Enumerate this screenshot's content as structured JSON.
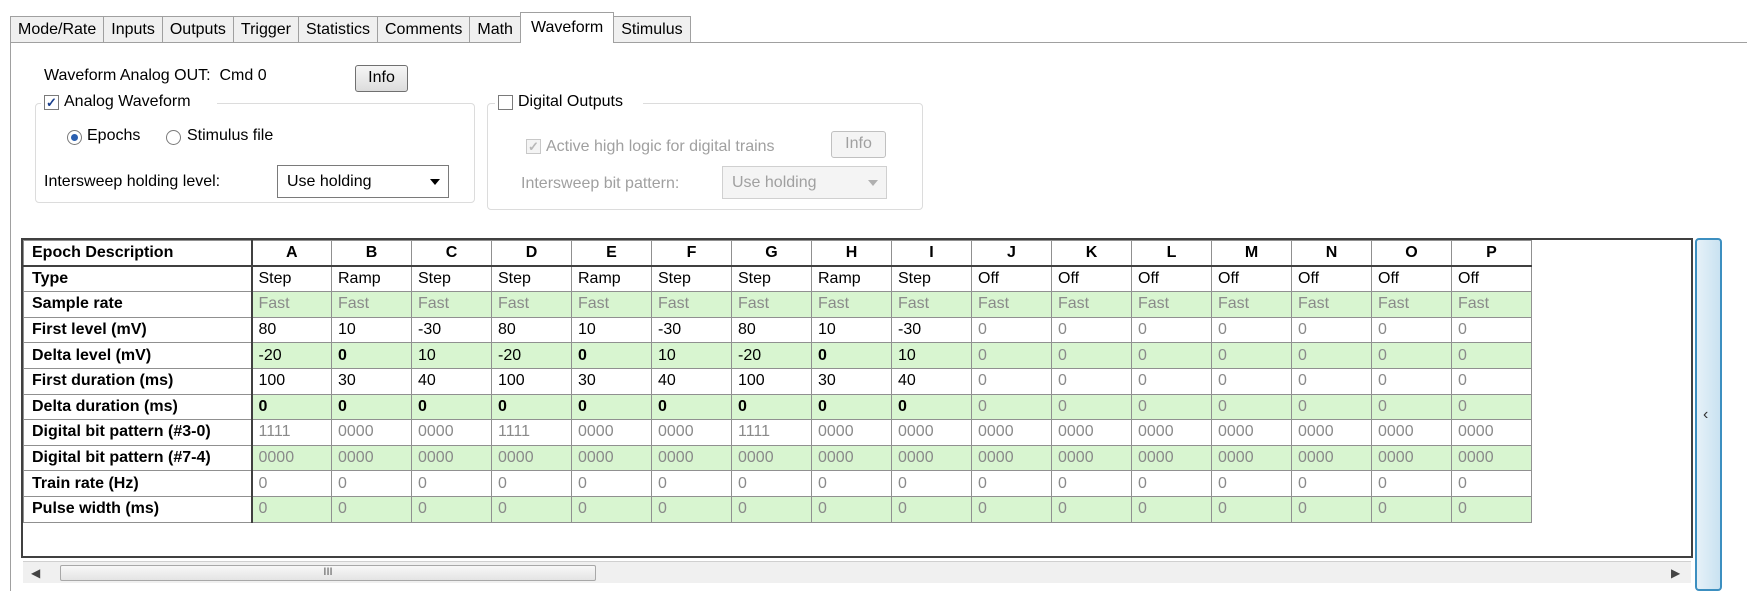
{
  "tabs": [
    {
      "label": "Mode/Rate",
      "active": false
    },
    {
      "label": "Inputs",
      "active": false
    },
    {
      "label": "Outputs",
      "active": false
    },
    {
      "label": "Trigger",
      "active": false
    },
    {
      "label": "Statistics",
      "active": false
    },
    {
      "label": "Comments",
      "active": false
    },
    {
      "label": "Math",
      "active": false
    },
    {
      "label": "Waveform",
      "active": true
    },
    {
      "label": "Stimulus",
      "active": false
    }
  ],
  "waveform_out": {
    "label": "Waveform Analog OUT:",
    "channel": "Cmd 0",
    "info_button": "Info"
  },
  "analog": {
    "checkbox_label": "Analog Waveform",
    "checked": true,
    "epochs_label": "Epochs",
    "stimulus_file_label": "Stimulus file",
    "selected": "Epochs",
    "holding_label": "Intersweep holding level:",
    "holding_value": "Use holding"
  },
  "digital": {
    "checkbox_label": "Digital Outputs",
    "checked": false,
    "active_high_label": "Active high logic for digital trains",
    "active_high_checked": true,
    "info_button": "Info",
    "bit_pattern_label": "Intersweep bit pattern:",
    "bit_pattern_value": "Use holding"
  },
  "grid": {
    "header": "Epoch Description",
    "columns": [
      "A",
      "B",
      "C",
      "D",
      "E",
      "F",
      "G",
      "H",
      "I",
      "J",
      "K",
      "L",
      "M",
      "N",
      "O",
      "P"
    ],
    "rows": [
      {
        "label": "Type",
        "shade": "white",
        "values": [
          "Step",
          "Ramp",
          "Step",
          "Step",
          "Ramp",
          "Step",
          "Step",
          "Ramp",
          "Step",
          "Off",
          "Off",
          "Off",
          "Off",
          "Off",
          "Off",
          "Off"
        ]
      },
      {
        "label": "Sample rate",
        "shade": "green",
        "values": [
          "Fast",
          "Fast",
          "Fast",
          "Fast",
          "Fast",
          "Fast",
          "Fast",
          "Fast",
          "Fast",
          "Fast",
          "Fast",
          "Fast",
          "Fast",
          "Fast",
          "Fast",
          "Fast"
        ]
      },
      {
        "label": "First level (mV)",
        "shade": "white",
        "values": [
          "80",
          "10",
          "-30",
          "80",
          "10",
          "-30",
          "80",
          "10",
          "-30",
          "0",
          "0",
          "0",
          "0",
          "0",
          "0",
          "0"
        ]
      },
      {
        "label": "Delta level (mV)",
        "shade": "green",
        "values": [
          "-20",
          "0",
          "10",
          "-20",
          "0",
          "10",
          "-20",
          "0",
          "10",
          "0",
          "0",
          "0",
          "0",
          "0",
          "0",
          "0"
        ]
      },
      {
        "label": "First duration (ms)",
        "shade": "white",
        "values": [
          "100",
          "30",
          "40",
          "100",
          "30",
          "40",
          "100",
          "30",
          "40",
          "0",
          "0",
          "0",
          "0",
          "0",
          "0",
          "0"
        ]
      },
      {
        "label": "Delta duration (ms)",
        "shade": "green",
        "values": [
          "0",
          "0",
          "0",
          "0",
          "0",
          "0",
          "0",
          "0",
          "0",
          "0",
          "0",
          "0",
          "0",
          "0",
          "0",
          "0"
        ]
      },
      {
        "label": "Digital bit pattern (#3-0)",
        "shade": "white",
        "values": [
          "1111",
          "0000",
          "0000",
          "1111",
          "0000",
          "0000",
          "1111",
          "0000",
          "0000",
          "0000",
          "0000",
          "0000",
          "0000",
          "0000",
          "0000",
          "0000"
        ]
      },
      {
        "label": "Digital bit pattern (#7-4)",
        "shade": "green",
        "values": [
          "0000",
          "0000",
          "0000",
          "0000",
          "0000",
          "0000",
          "0000",
          "0000",
          "0000",
          "0000",
          "0000",
          "0000",
          "0000",
          "0000",
          "0000",
          "0000"
        ]
      },
      {
        "label": "Train rate (Hz)",
        "shade": "white",
        "values": [
          "0",
          "0",
          "0",
          "0",
          "0",
          "0",
          "0",
          "0",
          "0",
          "0",
          "0",
          "0",
          "0",
          "0",
          "0",
          "0"
        ]
      },
      {
        "label": "Pulse width (ms)",
        "shade": "green",
        "values": [
          "0",
          "0",
          "0",
          "0",
          "0",
          "0",
          "0",
          "0",
          "0",
          "0",
          "0",
          "0",
          "0",
          "0",
          "0",
          "0"
        ]
      }
    ]
  },
  "hscroll": {
    "thumb_grip": "III"
  },
  "colors": {
    "green_row": "#d8f5d0",
    "disabled_text": "#a0a0a0"
  }
}
